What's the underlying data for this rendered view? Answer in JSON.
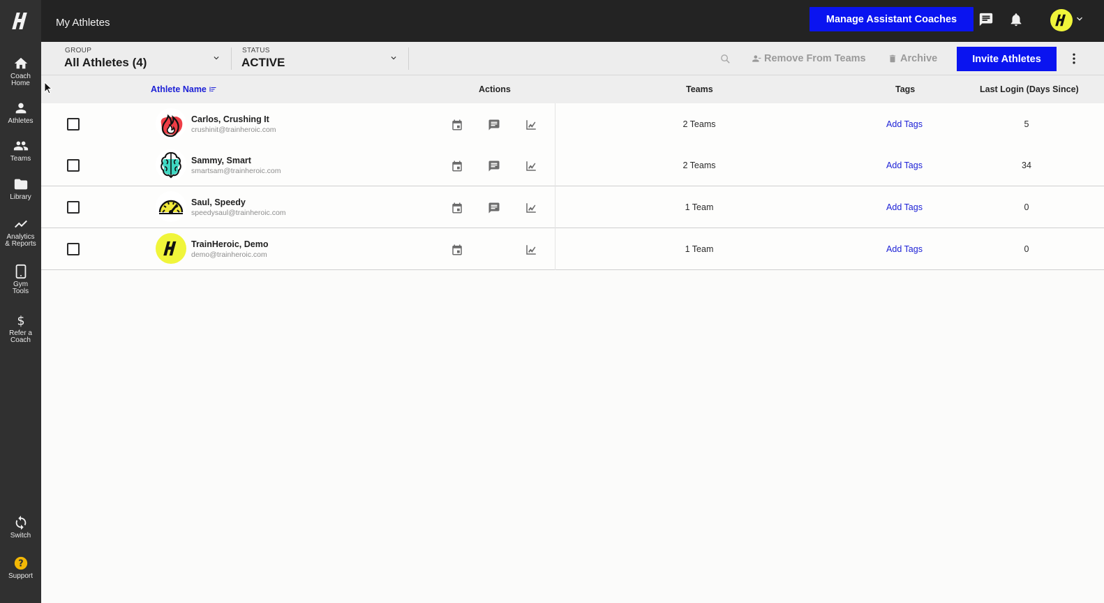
{
  "app": {
    "logo_letter": "H"
  },
  "sidebar": {
    "items": [
      {
        "label": "Coach\nHome",
        "icon": "home-icon"
      },
      {
        "label": "Athletes",
        "icon": "person-icon"
      },
      {
        "label": "Teams",
        "icon": "group-icon"
      },
      {
        "label": "Library",
        "icon": "folder-icon"
      },
      {
        "label": "Analytics\n& Reports",
        "icon": "trending-icon"
      },
      {
        "label": "Gym\nTools",
        "icon": "tablet-icon"
      },
      {
        "label": "Refer a\nCoach",
        "icon": "dollar-icon"
      }
    ],
    "bottom": [
      {
        "label": "Switch",
        "icon": "sync-icon"
      },
      {
        "label": "Support",
        "icon": "help-icon"
      }
    ]
  },
  "header": {
    "title": "My Athletes",
    "manage_button": "Manage Assistant Coaches",
    "avatar_letter": "H"
  },
  "filters": {
    "group_label": "GROUP",
    "group_value": "All Athletes (4)",
    "status_label": "STATUS",
    "status_value": "ACTIVE"
  },
  "toolbar": {
    "remove_label": "Remove From Teams",
    "archive_label": "Archive",
    "invite_label": "Invite Athletes"
  },
  "table": {
    "columns": {
      "name": "Athlete Name",
      "actions": "Actions",
      "teams": "Teams",
      "tags": "Tags",
      "last_login": "Last Login (Days Since)"
    },
    "rows": [
      {
        "name": "Carlos, Crushing It",
        "email": "crushinit@trainheroic.com",
        "teams": "2 Teams",
        "tags": "Add Tags",
        "last_login": "5",
        "avatar": "flame-avatar",
        "has_message": true
      },
      {
        "name": "Sammy, Smart",
        "email": "smartsam@trainheroic.com",
        "teams": "2 Teams",
        "tags": "Add Tags",
        "last_login": "34",
        "avatar": "brain-avatar",
        "has_message": true
      },
      {
        "name": "Saul, Speedy",
        "email": "speedysaul@trainheroic.com",
        "teams": "1 Team",
        "tags": "Add Tags",
        "last_login": "0",
        "avatar": "speedometer-avatar",
        "has_message": true
      },
      {
        "name": "TrainHeroic, Demo",
        "email": "demo@trainheroic.com",
        "teams": "1 Team",
        "tags": "Add Tags",
        "last_login": "0",
        "avatar": "trainheroic-avatar",
        "avatar_letter": "H",
        "has_message": false
      }
    ]
  },
  "colors": {
    "primary": "#0a14f0",
    "link": "#1d21d6",
    "sidebar_bg": "#303030",
    "topbar_bg": "#232323",
    "brand_yellow": "#f0f53a"
  }
}
